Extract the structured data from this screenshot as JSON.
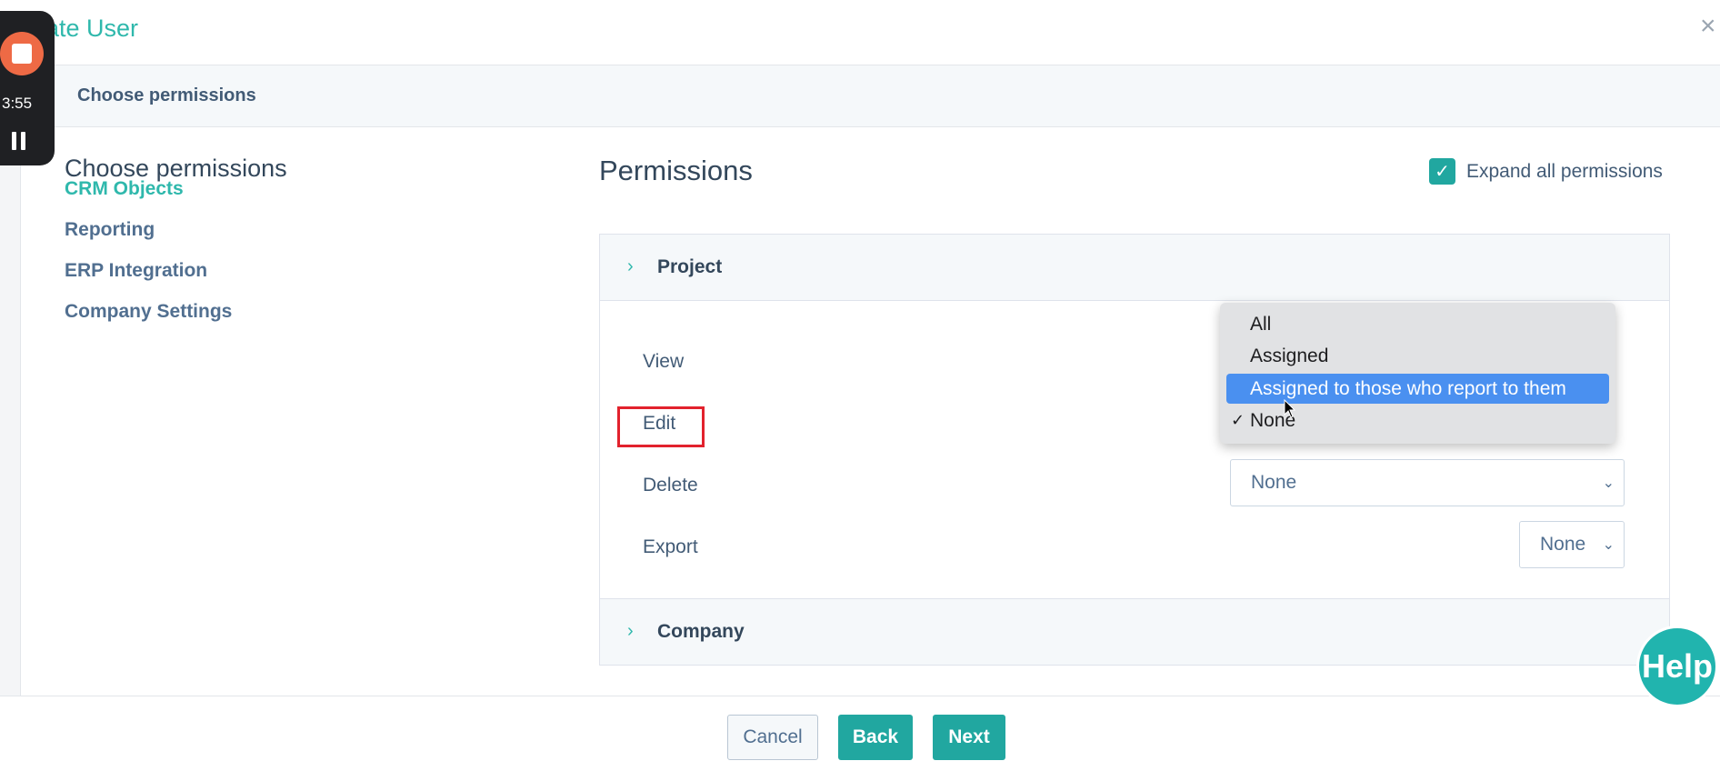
{
  "header": {
    "title": "ate User",
    "close_icon": "×"
  },
  "stepbar": {
    "label": "Choose permissions"
  },
  "left": {
    "title": "Choose permissions",
    "nav": [
      "CRM Objects",
      "Reporting",
      "ERP Integration",
      "Company Settings"
    ],
    "active_index": 0
  },
  "permissions": {
    "title": "Permissions",
    "expand_label": "Expand all permissions",
    "expand_checked": true
  },
  "sections": {
    "project": {
      "label": "Project",
      "chevron": "›"
    },
    "company": {
      "label": "Company",
      "chevron": "›"
    }
  },
  "rows": {
    "view": "View",
    "edit": "Edit",
    "delete": {
      "label": "Delete",
      "value": "None"
    },
    "export": {
      "label": "Export",
      "value": "None"
    }
  },
  "dropdown": {
    "options": [
      "All",
      "Assigned",
      "Assigned to those who report to them",
      "None"
    ],
    "highlighted": "Assigned to those who report to them",
    "selected": "None",
    "check": "✓"
  },
  "footer": {
    "cancel": "Cancel",
    "back": "Back",
    "next": "Next"
  },
  "recorder": {
    "time": "3:55"
  },
  "help": {
    "label": "Help"
  },
  "colors": {
    "accent": "#21a7a0",
    "title_teal": "#2fb8ac",
    "highlight_blue": "#4a90f0",
    "edit_box_red": "#e2222d"
  }
}
